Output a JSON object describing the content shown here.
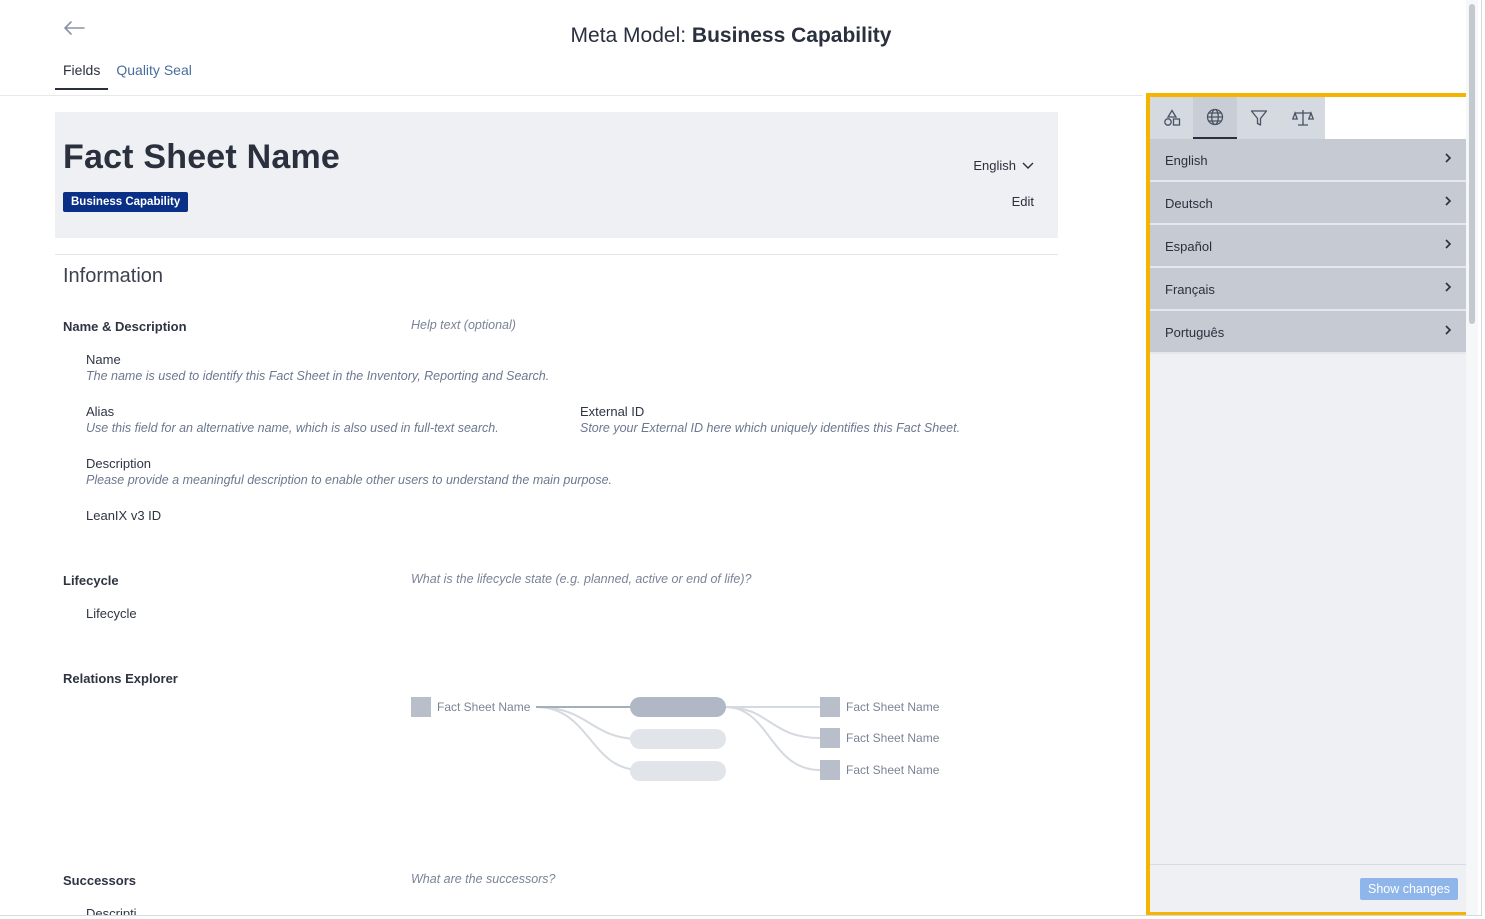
{
  "header": {
    "title_prefix": "Meta Model: ",
    "title_main": "Business Capability",
    "tabs": [
      {
        "label": "Fields",
        "active": true
      },
      {
        "label": "Quality Seal",
        "active": false
      }
    ]
  },
  "fact_sheet": {
    "title": "Fact Sheet Name",
    "badge": "Business Capability",
    "language": "English",
    "edit_label": "Edit"
  },
  "section": {
    "heading": "Information",
    "groups": {
      "name_description": {
        "label": "Name & Description",
        "help": "Help text (optional)",
        "fields": {
          "name": {
            "label": "Name",
            "desc": "The name is used to identify this Fact Sheet in the Inventory, Reporting and Search."
          },
          "alias": {
            "label": "Alias",
            "desc": "Use this field for an alternative name, which is also used in full-text search."
          },
          "external_id": {
            "label": "External ID",
            "desc": "Store your External ID here which uniquely identifies this Fact Sheet."
          },
          "description": {
            "label": "Description",
            "desc": "Please provide a meaningful description to enable other users to understand the main purpose."
          },
          "leanix_id": {
            "label": "LeanIX v3 ID"
          }
        }
      },
      "lifecycle": {
        "label": "Lifecycle",
        "help": "What is the lifecycle state (e.g. planned, active or end of life)?",
        "field": "Lifecycle"
      },
      "relations": {
        "label": "Relations Explorer",
        "left_node": "Fact Sheet Name",
        "right_nodes": [
          "Fact Sheet Name",
          "Fact Sheet Name",
          "Fact Sheet Name"
        ]
      },
      "successors": {
        "label": "Successors",
        "help": "What are the successors?",
        "partial_field": "Descripti"
      }
    }
  },
  "panel": {
    "tools": [
      "shapes-icon",
      "globe-icon",
      "filter-icon",
      "scale-icon"
    ],
    "active_tool": "globe-icon",
    "languages": [
      "English",
      "Deutsch",
      "Español",
      "Français",
      "Português"
    ],
    "show_changes_label": "Show changes",
    "highlight_color": "#f4b400"
  },
  "colors": {
    "badge": "#0a2f86",
    "tab_link": "#4a6e9c",
    "button": "#8fb6ea"
  }
}
